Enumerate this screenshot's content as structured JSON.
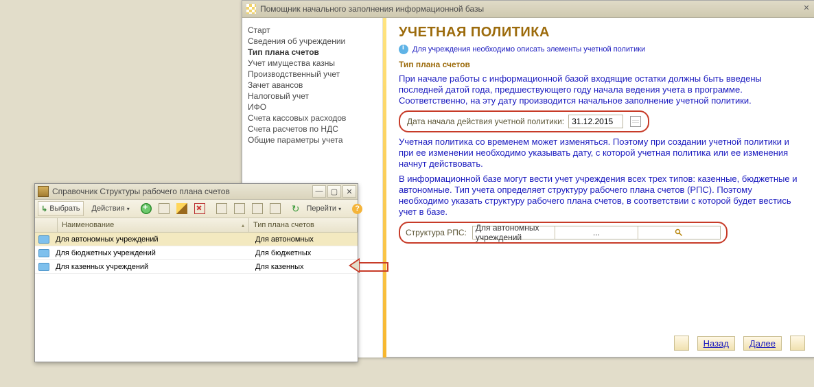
{
  "main": {
    "title": "Помощник начального заполнения информационной базы",
    "nav": {
      "items": [
        {
          "label": "Старт"
        },
        {
          "label": "Сведения об учреждении"
        },
        {
          "label": "Тип плана счетов"
        },
        {
          "label": "Учет имущества казны"
        },
        {
          "label": "Производственный учет"
        },
        {
          "label": "Зачет авансов"
        },
        {
          "label": "Налоговый учет"
        },
        {
          "label": "ИФО"
        },
        {
          "label": "Счета кассовых расходов"
        },
        {
          "label": "Счета расчетов по НДС"
        },
        {
          "label": "Общие параметры учета"
        }
      ],
      "current_index": 2
    },
    "content": {
      "heading": "УЧЕТНАЯ ПОЛИТИКА",
      "hint": "Для учреждения необходимо описать элементы учетной политики",
      "section_title": "Тип плана счетов",
      "para1": "При начале работы с информационной базой входящие остатки должны быть введены последней датой года, предшествующего году начала ведения учета в программе. Соответственно, на эту дату производится начальное заполнение учетной политики.",
      "date_label": "Дата начала действия учетной политики:",
      "date_value": "31.12.2015",
      "para2": "Учетная политика со временем может изменяться. Поэтому при создании учетной политики и при ее изменении необходимо указывать дату, с которой учетная политика или ее изменения начнут действовать.",
      "para3": "В информационной базе могут вести учет учреждения всех трех типов: казенные, бюджетные и автономные. Тип учета определяет структуру рабочего плана счетов (РПС). Поэтому необходимо указать структуру рабочего плана счетов, в соответствии с которой будет вестись учет в базе.",
      "rps_label": "Структура РПС:",
      "rps_value": "Для автономных учреждений"
    },
    "back_label": "Назад",
    "next_label": "Далее"
  },
  "catalog": {
    "title": "Справочник Структуры рабочего плана счетов",
    "toolbar": {
      "select": "Выбрать",
      "actions": "Действия",
      "goto": "Перейти"
    },
    "columns": {
      "name": "Наименование",
      "type": "Тип плана счетов"
    },
    "rows": [
      {
        "name": "Для автономных учреждений",
        "type": "Для автономных"
      },
      {
        "name": "Для бюджетных учреждений",
        "type": "Для бюджетных"
      },
      {
        "name": "Для казенных учреждений",
        "type": "Для казенных"
      }
    ],
    "selected_index": 0
  }
}
